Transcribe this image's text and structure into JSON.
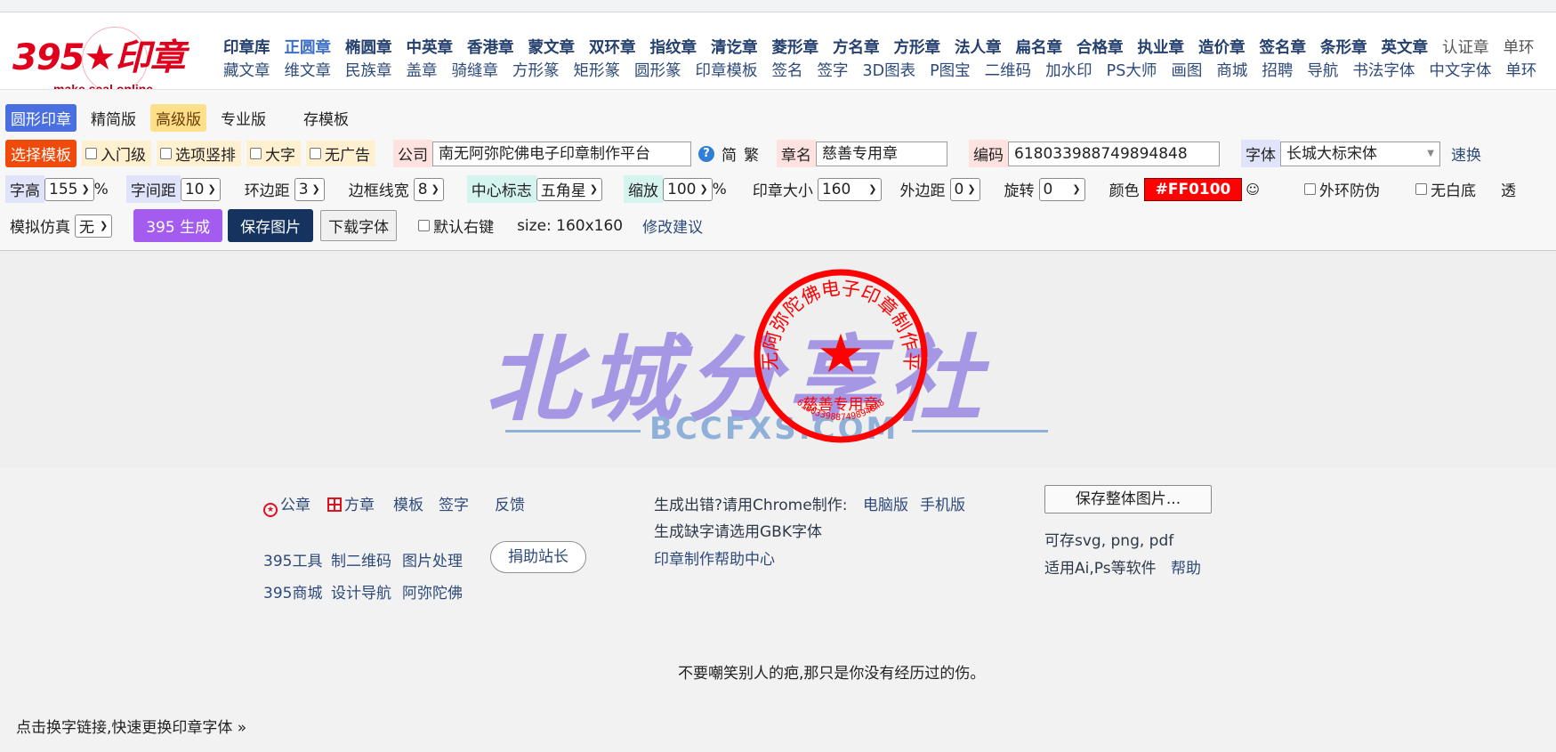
{
  "logo": {
    "main": "395★印章",
    "sub": "make seal online"
  },
  "nav_primary": [
    "印章库",
    "正圆章",
    "椭圆章",
    "中英章",
    "香港章",
    "蒙文章",
    "双环章",
    "指纹章",
    "清讫章",
    "菱形章",
    "方名章",
    "方形章",
    "法人章",
    "扁名章",
    "合格章",
    "执业章",
    "造价章",
    "签名章",
    "条形章",
    "英文章",
    "认证章",
    "单环"
  ],
  "nav_secondary": [
    "藏文章",
    "维文章",
    "民族章",
    "盖章",
    "骑缝章",
    "方形篆",
    "矩形篆",
    "圆形篆",
    "印章模板",
    "签名",
    "签字",
    "3D图表",
    "P图宝",
    "二维码",
    "加水印",
    "PS大师",
    "画图",
    "商城",
    "招聘",
    "导航",
    "书法字体",
    "中文字体",
    "单环"
  ],
  "tabs": {
    "circle_seal": "圆形印章",
    "simple": "精简版",
    "advanced": "高级版",
    "pro": "专业版",
    "save_template": "存模板"
  },
  "row2": {
    "choose_template": "选择模板",
    "beginner": "入门级",
    "vertical": "选项竖排",
    "big_text": "大字",
    "no_ads": "无广告",
    "company_label": "公司",
    "company_value": "南无阿弥陀佛电子印章制作平台",
    "simplified": "简",
    "traditional": "繁",
    "seal_name_label": "章名",
    "seal_name_value": "慈善专用章",
    "code_label": "编码",
    "code_value": "618033988749894848",
    "font_label": "字体",
    "font_value": "长城大标宋体",
    "quick_switch": "速换"
  },
  "row3": {
    "char_height_label": "字高",
    "char_height_value": "155",
    "percent": "%",
    "char_spacing_label": "字间距",
    "char_spacing_value": "10",
    "ring_margin_label": "环边距",
    "ring_margin_value": "3",
    "border_width_label": "边框线宽",
    "border_width_value": "8",
    "center_mark_label": "中心标志",
    "center_mark_value": "五角星",
    "scale_label": "缩放",
    "scale_value": "100",
    "seal_size_label": "印章大小",
    "seal_size_value": "160",
    "outer_margin_label": "外边距",
    "outer_margin_value": "0",
    "rotate_label": "旋转",
    "rotate_value": "0",
    "color_label": "颜色",
    "color_value": "#FF0100",
    "anti_fake": "外环防伪",
    "no_white_bg": "无白底",
    "transparent": "透"
  },
  "row4": {
    "simulate_label": "模拟仿真",
    "simulate_value": "无",
    "generate": "395 生成",
    "save_image": "保存图片",
    "download_font": "下载字体",
    "default_right_click": "默认右键",
    "size_text": "size: 160x160",
    "suggestion": "修改建议"
  },
  "watermark": {
    "main": "北城分享社",
    "sub": "BCCFXS.COM"
  },
  "seal": {
    "arc_text": "南无阿弥陀佛电子印章制作平台",
    "name": "慈善专用章",
    "code": "618033988749894848",
    "star": "★",
    "color": "#FF0100"
  },
  "footer": {
    "official_seal": "公章",
    "square_seal": "方章",
    "template": "模板",
    "signature": "签字",
    "feedback": "反馈",
    "tools": "395工具",
    "qr": "制二维码",
    "image_process": "图片处理",
    "donate": "捐助站长",
    "mall": "395商城",
    "design_nav": "设计导航",
    "amitabha": "阿弥陀佛",
    "error_tip": "生成出错?请用Chrome制作:",
    "pc_version": "电脑版",
    "mobile_version": "手机版",
    "gbk_tip": "生成缺字请选用GBK字体",
    "help_center": "印章制作帮助中心",
    "save_whole": "保存整体图片...",
    "formats": "可存svg, png, pdf",
    "software": "适用Ai,Ps等软件",
    "help": "帮助",
    "quote": "不要嘲笑别人的疤,那只是你没有经历过的伤。",
    "font_link": "点击换字链接,快速更换印章字体 »"
  }
}
